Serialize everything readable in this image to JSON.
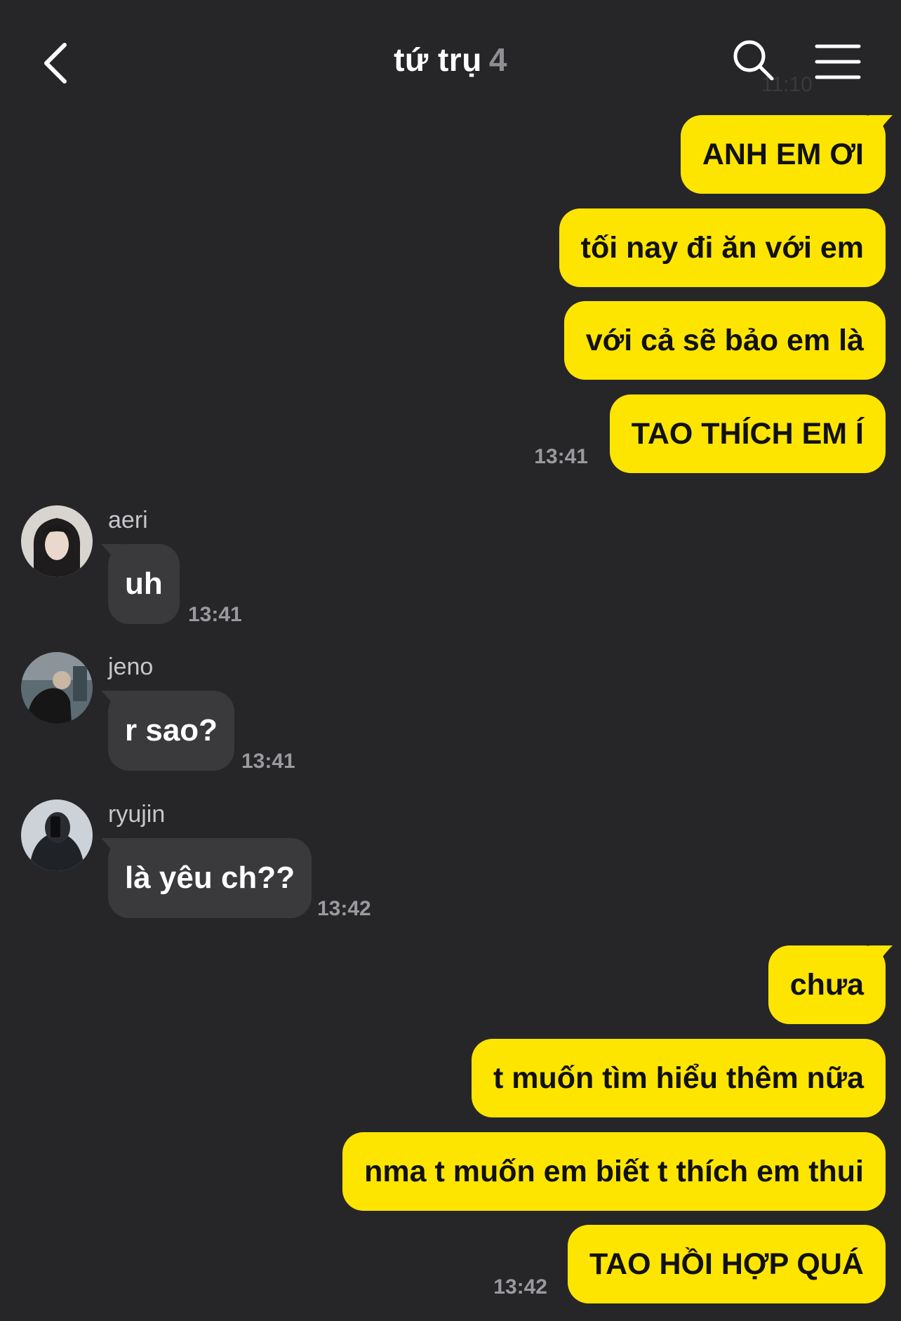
{
  "header": {
    "title": "tứ trụ",
    "member_count": "4",
    "ghost_time": "11:10",
    "back_icon": "chevron-left-icon",
    "search_icon": "search-icon",
    "menu_icon": "menu-icon"
  },
  "colors": {
    "background": "#262629",
    "outgoing_bubble": "#fee500",
    "incoming_bubble": "#3a3a3c",
    "timestamp": "#9a9a9e"
  },
  "messages": {
    "g1": {
      "m1": "ANH EM ƠI",
      "m2": "tối nay đi ăn với em",
      "m3": "với cả sẽ bảo em là",
      "m4": "TAO THÍCH EM Í",
      "time": "13:41"
    },
    "aeri": {
      "sender": "aeri",
      "text": "uh",
      "time": "13:41"
    },
    "jeno": {
      "sender": "jeno",
      "text": "r sao?",
      "time": "13:41"
    },
    "ryujin": {
      "sender": "ryujin",
      "text": "là yêu ch??",
      "time": "13:42"
    },
    "g2": {
      "m1": "chưa",
      "m2": "t muốn tìm hiểu thêm nữa",
      "m3": "nma t muốn em biết t thích em thui",
      "m4": "TAO HỒI HỢP QUÁ",
      "time": "13:42"
    }
  }
}
